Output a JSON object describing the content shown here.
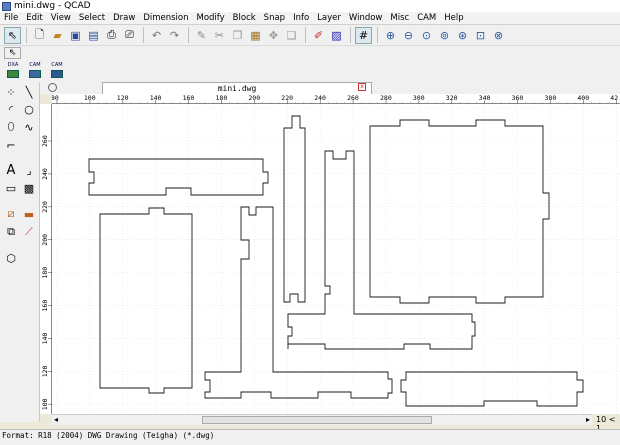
{
  "window": {
    "title": "mini.dwg - QCAD"
  },
  "menu": [
    "File",
    "Edit",
    "View",
    "Select",
    "Draw",
    "Dimension",
    "Modify",
    "Block",
    "Snap",
    "Info",
    "Layer",
    "Window",
    "Misc",
    "CAM",
    "Help"
  ],
  "toolbar1_icons": [
    "select-pointer-icon",
    "new-file-icon",
    "open-file-icon",
    "save-icon",
    "save-as-icon",
    "print-icon",
    "print-preview-icon",
    "undo-icon",
    "redo-icon",
    "edit-pencil-icon",
    "cut-icon",
    "copy-icon",
    "paste-icon",
    "copy-with-reference-icon",
    "paste-block-icon",
    "draw-red-pen-icon",
    "block-view-icon",
    "grid-icon",
    "zoom-in-icon",
    "zoom-out-icon",
    "zoom-auto-icon",
    "zoom-previous-icon",
    "zoom-redraw-icon",
    "zoom-window-icon",
    "zoom-pan-icon"
  ],
  "toolbar2_icons": [
    "select-arrow-icon"
  ],
  "toolbar3_labels": [
    "DXA",
    "CAM",
    "CAM"
  ],
  "tab": {
    "label": "mini.dwg",
    "close": "x"
  },
  "rulers": {
    "x_ticks": [
      "80",
      "100",
      "120",
      "140",
      "160",
      "180",
      "200",
      "220",
      "240",
      "260",
      "280",
      "300",
      "320",
      "340",
      "360",
      "380",
      "400",
      "42"
    ],
    "y_ticks": [
      "260",
      "240",
      "220",
      "200",
      "180",
      "160",
      "140",
      "120",
      "100"
    ]
  },
  "scroll": {
    "page_info": "10 < 1"
  },
  "status": {
    "text": "Format: R18 (2004) DWG Drawing (Teigha) (*.dwg)"
  },
  "colors": {
    "canvas": "#ffffff",
    "shape_stroke": "#1a1a1a",
    "grid": "#e6e6e6"
  }
}
